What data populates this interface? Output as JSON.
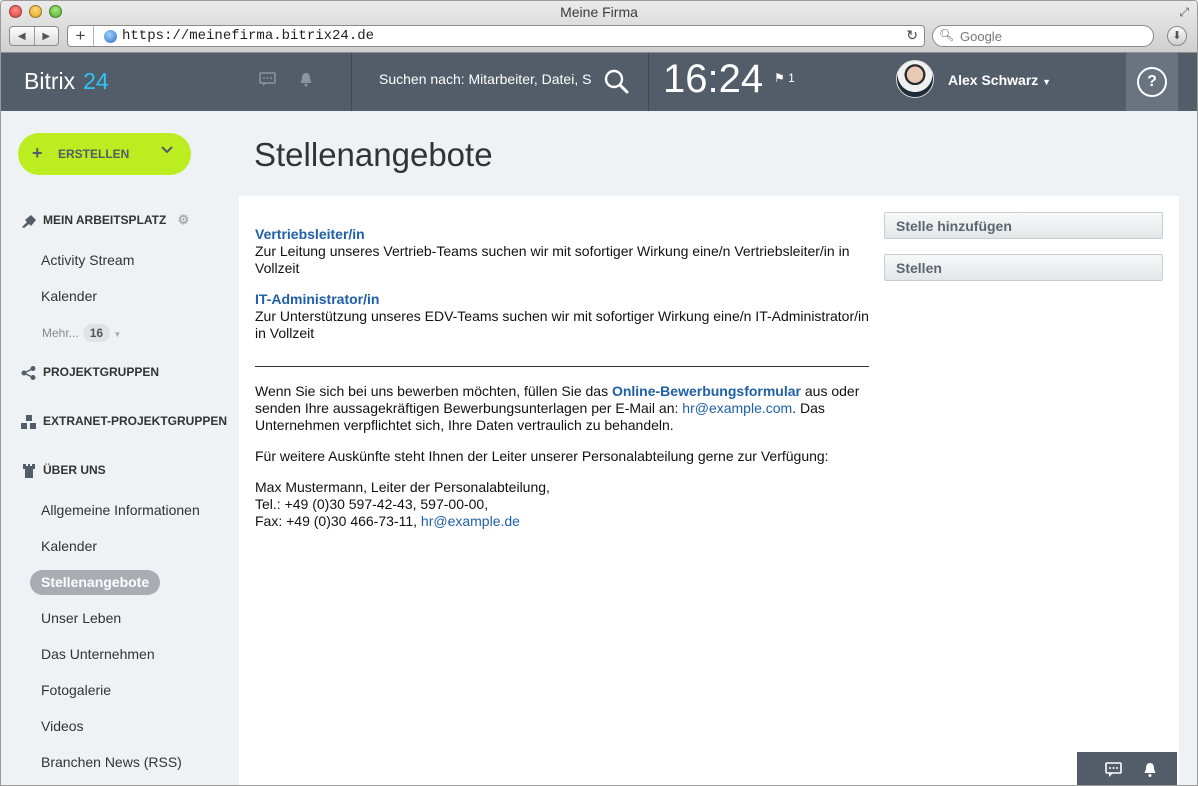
{
  "browser": {
    "window_title": "Meine Firma",
    "url": "https://meinefirma.bitrix24.de",
    "search_placeholder": "Google"
  },
  "header": {
    "logo_text": "Bitrix",
    "logo_number": "24",
    "search_placeholder": "Suchen nach: Mitarbeiter, Datei, S",
    "clock": "16:24",
    "flag_count": "1",
    "user_name": "Alex Schwarz",
    "help_label": "?"
  },
  "sidebar": {
    "create_label": "ERSTELLEN",
    "section_workspace": "MEIN ARBEITSPLATZ",
    "workspace_items": [
      "Activity Stream",
      "Kalender"
    ],
    "more_label": "Mehr...",
    "more_count": "16",
    "section_projects": "PROJEKTGRUPPEN",
    "section_extranet": "EXTRANET-PROJEKTGRUPPEN",
    "section_about": "ÜBER UNS",
    "about_items": [
      "Allgemeine Informationen",
      "Kalender",
      "Stellenangebote",
      "Unser Leben",
      "Das Unternehmen",
      "Fotogalerie",
      "Videos",
      "Branchen News (RSS)"
    ],
    "active_item": "Stellenangebote"
  },
  "main": {
    "title": "Stellenangebote",
    "jobs": [
      {
        "title": "Vertriebsleiter/in",
        "desc": "Zur Leitung unseres Vertrieb-Teams suchen wir mit sofortiger Wirkung eine/n Vertriebsleiter/in in Vollzeit"
      },
      {
        "title": "IT-Administrator/in",
        "desc": "Zur Unterstützung unseres EDV-Teams suchen wir mit sofortiger Wirkung eine/n IT-Administrator/in in Vollzeit"
      }
    ],
    "apply_text_1": "Wenn Sie sich bei uns bewerben möchten, füllen Sie das ",
    "apply_link": "Online-Bewerbungsformular",
    "apply_text_2": " aus oder senden Ihre aussagekräftigen Bewerbungsunterlagen per E-Mail an: ",
    "apply_email": "hr@example.com",
    "apply_text_3": ". Das Unternehmen verpflichtet sich, Ihre Daten vertraulich zu behandeln.",
    "info_text": "Für weitere Auskünfte steht Ihnen der Leiter unserer Personalabteilung gerne zur Verfügung:",
    "contact_name": "Max Mustermann, Leiter der Personalabteilung,",
    "contact_tel": "Tel.: +49 (0)30 597-42-43, 597-00-00,",
    "contact_fax": "Fax: +49 (0)30 466-73-11, ",
    "contact_email": "hr@example.de",
    "add_job_button": "Stelle hinzufügen",
    "jobs_button": "Stellen"
  }
}
